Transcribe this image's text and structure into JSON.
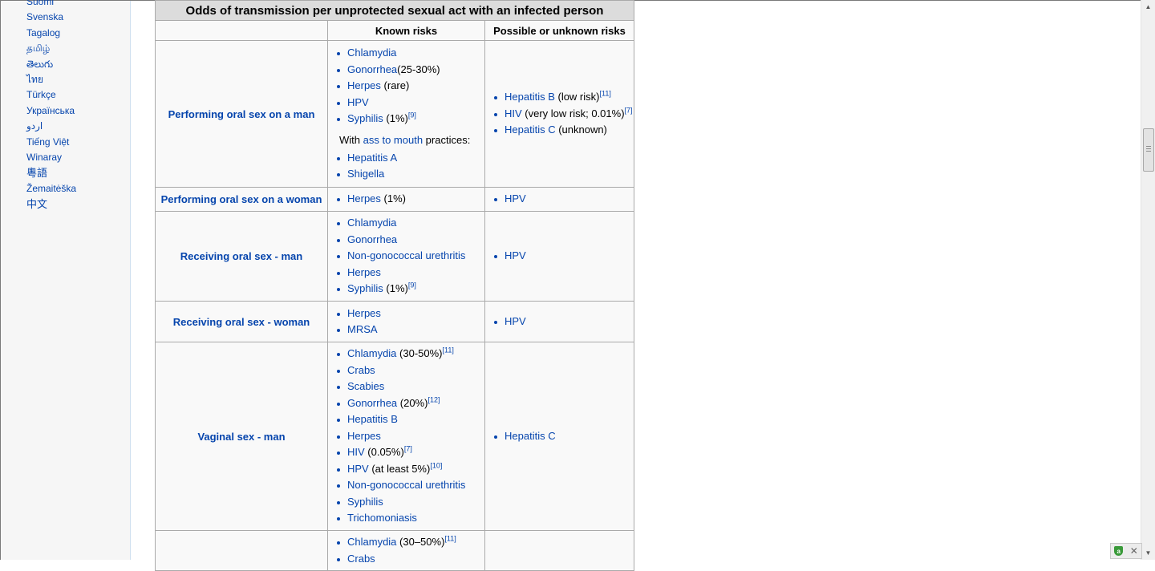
{
  "sidebar": {
    "languages": [
      "Suomi",
      "Svenska",
      "Tagalog",
      "தமிழ்",
      "తెలుగు",
      "ไทย",
      "Türkçe",
      "Українська",
      "اردو",
      "Tiếng Việt",
      "Winaray",
      "粵語",
      "Žemaitėška",
      "中文"
    ]
  },
  "table": {
    "caption": "Odds of transmission per unprotected sexual act with an infected person",
    "col_known": "Known risks",
    "col_possible": "Possible or unknown risks",
    "rows": [
      {
        "label": "Performing oral sex on a man",
        "known": [
          {
            "name": "Chlamydia",
            "note": "",
            "ref": ""
          },
          {
            "name": "Gonorrhea",
            "note": "(25-30%)",
            "ref": ""
          },
          {
            "name": "Herpes",
            "note": " (rare)",
            "ref": ""
          },
          {
            "name": "HPV",
            "note": "",
            "ref": ""
          },
          {
            "name": "Syphilis",
            "note": " (1%)",
            "ref": "[9]"
          }
        ],
        "subnote": {
          "prefix": "With ",
          "link": "ass to mouth",
          "suffix": " practices:"
        },
        "known_extra": [
          {
            "name": "Hepatitis A",
            "note": "",
            "ref": ""
          },
          {
            "name": "Shigella",
            "note": "",
            "ref": ""
          }
        ],
        "possible": [
          {
            "name": "Hepatitis B",
            "note": " (low risk)",
            "ref": "[11]"
          },
          {
            "name": "HIV",
            "note": " (very low risk; 0.01%)",
            "ref": "[7]"
          },
          {
            "name": "Hepatitis C",
            "note": " (unknown)",
            "ref": ""
          }
        ]
      },
      {
        "label": "Performing oral sex on a woman",
        "known": [
          {
            "name": "Herpes",
            "note": " (1%)",
            "ref": ""
          }
        ],
        "possible": [
          {
            "name": "HPV",
            "note": "",
            "ref": ""
          }
        ]
      },
      {
        "label": "Receiving oral sex - man",
        "known": [
          {
            "name": "Chlamydia",
            "note": "",
            "ref": ""
          },
          {
            "name": "Gonorrhea",
            "note": "",
            "ref": ""
          },
          {
            "name": "Non-gonococcal urethritis",
            "note": "",
            "ref": ""
          },
          {
            "name": "Herpes",
            "note": "",
            "ref": ""
          },
          {
            "name": "Syphilis",
            "note": " (1%)",
            "ref": "[9]"
          }
        ],
        "possible": [
          {
            "name": "HPV",
            "note": "",
            "ref": ""
          }
        ]
      },
      {
        "label": "Receiving oral sex - woman",
        "known": [
          {
            "name": "Herpes",
            "note": "",
            "ref": ""
          },
          {
            "name": "MRSA",
            "note": "",
            "ref": ""
          }
        ],
        "possible": [
          {
            "name": "HPV",
            "note": "",
            "ref": ""
          }
        ]
      },
      {
        "label": "Vaginal sex - man",
        "known": [
          {
            "name": "Chlamydia",
            "note": " (30-50%)",
            "ref": "[11]"
          },
          {
            "name": "Crabs",
            "note": "",
            "ref": ""
          },
          {
            "name": "Scabies",
            "note": "",
            "ref": ""
          },
          {
            "name": "Gonorrhea",
            "note": " (20%)",
            "ref": "[12]"
          },
          {
            "name": "Hepatitis B",
            "note": "",
            "ref": ""
          },
          {
            "name": "Herpes",
            "note": "",
            "ref": ""
          },
          {
            "name": "HIV",
            "note": " (0.05%)",
            "ref": "[7]"
          },
          {
            "name": "HPV",
            "note": " (at least 5%)",
            "ref": "[10]"
          },
          {
            "name": "Non-gonococcal urethritis",
            "note": "",
            "ref": ""
          },
          {
            "name": "Syphilis",
            "note": "",
            "ref": ""
          },
          {
            "name": "Trichomoniasis",
            "note": "",
            "ref": ""
          }
        ],
        "possible": [
          {
            "name": "Hepatitis C",
            "note": "",
            "ref": ""
          }
        ]
      },
      {
        "label": "",
        "known": [
          {
            "name": "Chlamydia",
            "note": " (30–50%)",
            "ref": "[11]"
          },
          {
            "name": "Crabs",
            "note": "",
            "ref": ""
          }
        ],
        "possible": []
      }
    ]
  }
}
